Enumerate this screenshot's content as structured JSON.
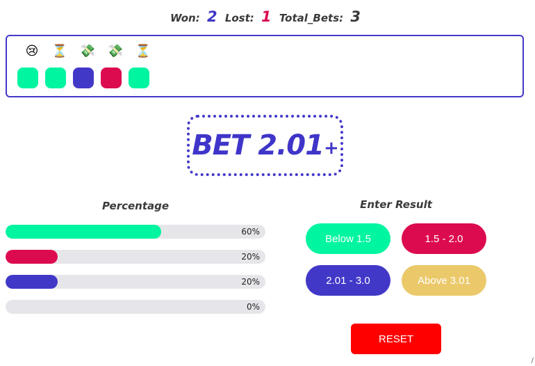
{
  "stats": {
    "won_label": "Won:",
    "won_value": "2",
    "lost_label": "Lost:",
    "lost_value": "1",
    "total_label": "Total_Bets:",
    "total_value": "3"
  },
  "history": {
    "emojis": [
      "😢",
      "⏳",
      "💸",
      "💸",
      "⏳"
    ],
    "squares": [
      {
        "color": "#00f5a0"
      },
      {
        "color": "#00f5a0"
      },
      {
        "color": "#4238c8"
      },
      {
        "color": "#dc0b4f"
      },
      {
        "color": "#00f5a0"
      }
    ]
  },
  "bet": {
    "text": "BET 2.01",
    "plus": "+"
  },
  "percentage": {
    "title": "Percentage",
    "bars": [
      {
        "label": "60%",
        "value": 0.6,
        "color": "#00f5a0"
      },
      {
        "label": "20%",
        "value": 0.2,
        "color": "#dc0b4f"
      },
      {
        "label": "20%",
        "value": 0.2,
        "color": "#4238c8"
      },
      {
        "label": "0%",
        "value": 0.0,
        "color": "#00f5a0"
      }
    ]
  },
  "result": {
    "title": "Enter Result",
    "buttons": [
      {
        "label": "Below 1.5",
        "color": "#00f5a0"
      },
      {
        "label": "1.5 - 2.0",
        "color": "#dc0b4f"
      },
      {
        "label": "2.01 - 3.0",
        "color": "#4238c8"
      },
      {
        "label": "Above 3.01",
        "color": "#ebc96a"
      }
    ]
  },
  "reset_label": "RESET"
}
